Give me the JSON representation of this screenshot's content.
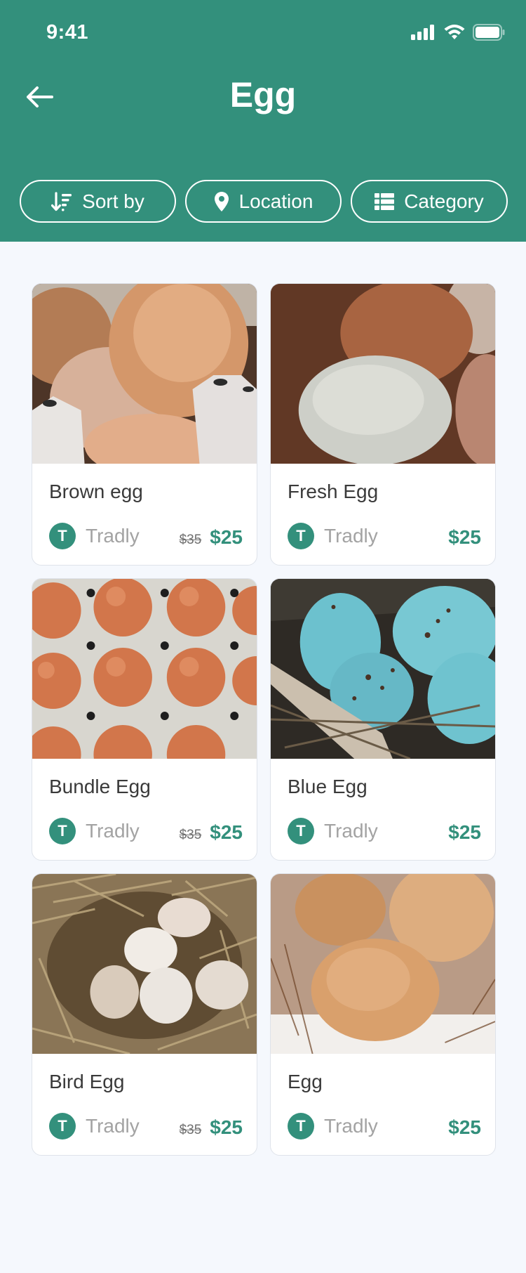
{
  "status_bar": {
    "time": "9:41"
  },
  "header": {
    "title": "Egg"
  },
  "filters": [
    {
      "label": "Sort by",
      "icon": "sort-icon"
    },
    {
      "label": "Location",
      "icon": "location-pin-icon"
    },
    {
      "label": "Category",
      "icon": "category-list-icon"
    }
  ],
  "products": [
    {
      "name": "Brown egg",
      "store": "Tradly",
      "store_initial": "T",
      "old_price": "$35",
      "price": "$25",
      "image": "brown-eggs-in-carton"
    },
    {
      "name": "Fresh Egg",
      "store": "Tradly",
      "store_initial": "T",
      "old_price": "",
      "price": "$25",
      "image": "white-and-brown-eggs-on-wood"
    },
    {
      "name": "Bundle Egg",
      "store": "Tradly",
      "store_initial": "T",
      "old_price": "$35",
      "price": "$25",
      "image": "egg-tray"
    },
    {
      "name": "Blue Egg",
      "store": "Tradly",
      "store_initial": "T",
      "old_price": "",
      "price": "$25",
      "image": "blue-eggs-in-nest"
    },
    {
      "name": "Bird Egg",
      "store": "Tradly",
      "store_initial": "T",
      "old_price": "$35",
      "price": "$25",
      "image": "small-eggs-in-straw-nest"
    },
    {
      "name": "Egg",
      "store": "Tradly",
      "store_initial": "T",
      "old_price": "",
      "price": "$25",
      "image": "brown-eggs-in-nest"
    }
  ],
  "colors": {
    "primary": "#33907c",
    "background": "#f5f8fd"
  }
}
